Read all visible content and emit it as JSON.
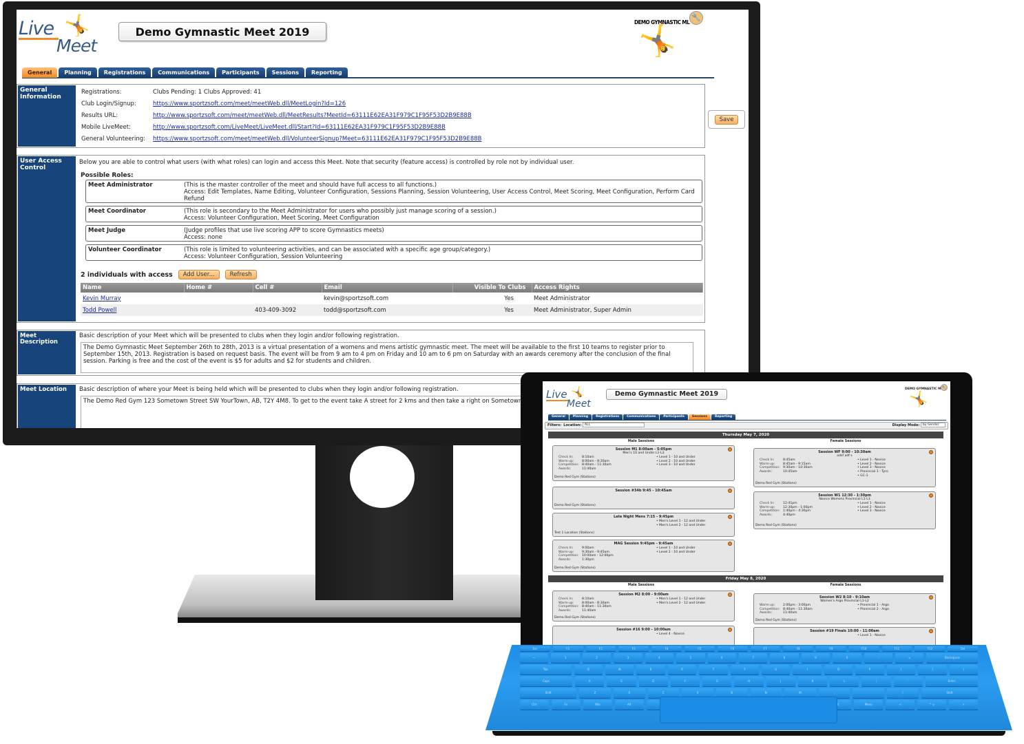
{
  "desktop": {
    "app_logo": {
      "line1": "Live",
      "line2": "Meet"
    },
    "meet_title": "Demo Gymnastic Meet 2019",
    "club_logo_text": "DEMO GYMNASTIC ML",
    "tabs": [
      {
        "label": "General",
        "active": true
      },
      {
        "label": "Planning",
        "active": false
      },
      {
        "label": "Registrations",
        "active": false
      },
      {
        "label": "Communications",
        "active": false
      },
      {
        "label": "Participants",
        "active": false
      },
      {
        "label": "Sessions",
        "active": false
      },
      {
        "label": "Reporting",
        "active": false
      }
    ],
    "save_label": "Save",
    "general_info": {
      "heading": "General Information",
      "rows": [
        {
          "label": "Registrations:",
          "value": "Clubs Pending: 1  Clubs Approved: 41",
          "link": false
        },
        {
          "label": "Club Login/Signup:",
          "value": "https://www.sportzsoft.com/meet/meetWeb.dll/MeetLogin?Id=126",
          "link": true
        },
        {
          "label": "Results URL:",
          "value": "http://www.sportzsoft.com/meet/meetWeb.dll/MeetResults?MeetId=63111E62EA31F979C1F95F53D2B9E88B",
          "link": true
        },
        {
          "label": "Mobile LiveMeet:",
          "value": "http://www.sportzsoft.com/LiveMeet/LiveMeet.dll/Start?Id=63111E62EA31F979C1F95F53D2B9E88B",
          "link": true
        },
        {
          "label": "General Volunteering:",
          "value": "https://www.sportzsoft.com/meet/meetWeb.dll/VolunteerSignup?Meet=63111E62EA31F979C1F95F53D2B9E88B",
          "link": true
        }
      ]
    },
    "user_access": {
      "heading": "User Access Control",
      "intro": "Below you are able to control what users (with what roles) can login and access this Meet. Note that security (feature access) is controlled by role not by individual user.",
      "roles_heading": "Possible Roles:",
      "roles": [
        {
          "name": "Meet Administrator",
          "desc": "(This is the master controller of the meet and should have full access to all functions.)",
          "access": "Access: Edit Templates, Name Editing, Volunteer Configuration, Sessions Planning, Session Volunteering, User Access Control, Meet Scoring, Meet Configuration, Perform Card Refund"
        },
        {
          "name": "Meet Coordinator",
          "desc": "(This role is secondary to the Meet Administrator for users who possibly just manage scoring of a session.)",
          "access": "Access: Volunteer Configuration, Meet Scoring, Meet Configuration"
        },
        {
          "name": "Meet Judge",
          "desc": "(Judge profiles that use live scoring APP to score Gymnastics meets)",
          "access": "Access: none"
        },
        {
          "name": "Volunteer Coordinator",
          "desc": "(This role is limited to volunteering activities, and can be associated with a specific age group/category.)",
          "access": "Access: Volunteer Configuration, Session Volunteering"
        }
      ],
      "count_label": "2 individuals with access",
      "add_user_label": "Add User...",
      "refresh_label": "Refresh",
      "columns": [
        "Name",
        "Home #",
        "Cell #",
        "Email",
        "Visible To Clubs",
        "Access Rights"
      ],
      "users": [
        {
          "name": "Kevin Murray",
          "home": "",
          "cell": "",
          "email": "kevin@sportzsoft.com",
          "visible": "Yes",
          "rights": "Meet Administrator"
        },
        {
          "name": "Todd Powell",
          "home": "",
          "cell": "403-409-3092",
          "email": "todd@sportzsoft.com",
          "visible": "Yes",
          "rights": "Meet Administrator, Super Admin"
        }
      ]
    },
    "meet_description": {
      "heading": "Meet Description",
      "hint": "Basic description of your Meet which will be presented to clubs when they login and/or following registration.",
      "value": "The Demo Gymnastic Meet September 26th to 28th,  2013 is a virtual presentation of a womens and mens artistic gymnastic meet. The meet will be available to the first 10 teams to register prior to September  15th, 2013. Registration is based on request basis. The event will be from 9 am to 4 pm on Friday and 10 am to 6 pm on Saturday with an awards ceremony after the conclusion of the final session. Parking is free and the cost of the event is $5 for adults and $2 for students and children."
    },
    "meet_location": {
      "heading": "Meet Location",
      "hint": "Basic description of where your Meet is being held which will be presented to clubs when they login and/or following registration.",
      "value": "The Demo Red Gym 123 Sometown Street SW YourTown, AB, T2Y 4M8. To get to the event take A street for 2 kms and then take a right on Sometown Parking is free for the weekend."
    }
  },
  "tablet": {
    "meet_title": "Demo Gymnastic Meet 2019",
    "club_logo_text": "DEMO GYMNASTIC ML",
    "tabs": [
      {
        "label": "General",
        "active": false
      },
      {
        "label": "Planning",
        "active": false
      },
      {
        "label": "Registrations",
        "active": false
      },
      {
        "label": "Communications",
        "active": false
      },
      {
        "label": "Participants",
        "active": false
      },
      {
        "label": "Sessions",
        "active": true
      },
      {
        "label": "Reporting",
        "active": false
      }
    ],
    "filters_label": "Filters:",
    "location_label": "Location:",
    "location_value": "ALL",
    "display_mode_label": "Display Mode:",
    "display_mode_value": "by Gender",
    "days": [
      {
        "date": "Thursday May 7, 2020",
        "male_heading": "Male Sessions",
        "female_heading": "Female Sessions",
        "male": [
          {
            "title": "Session M1 8:00am - 5:05pm",
            "subtitle": "Men's 10 and Under L1-L3",
            "times": [
              [
                "Check In:",
                "8:10am"
              ],
              [
                "Warm-up:",
                "8:00am - 8:30am"
              ],
              [
                "Competition:",
                "8:40am - 11:30am"
              ],
              [
                "Awards:",
                "11:40am"
              ]
            ],
            "levels": [
              "Level 1 - 10 and Under",
              "Level 2 - 10 and Under",
              "Level 3 - 10 and Under"
            ],
            "location": "Demo Red Gym (Stations)"
          },
          {
            "title": "Session #34b 9:45 - 10:45am",
            "subtitle": "",
            "times": [],
            "levels": [],
            "location": "Demo Red Gym (Stations)"
          },
          {
            "title": "Late Night Mens 7:15 - 9:45pm",
            "subtitle": "",
            "times": [],
            "levels": [
              "Men's Level 1 - 12 and Under",
              "Men's Level 2 - 12 and Under"
            ],
            "location": "Test 1 Location (Stations)"
          },
          {
            "title": "MAG Session 9:45pm - 9:45am",
            "subtitle": "",
            "times": [
              [
                "Check In:",
                "9:00am"
              ],
              [
                "Warm-up:",
                "9:30am - 9:45am"
              ],
              [
                "Competition:",
                "10:00am - 12:00pm"
              ],
              [
                "Awards:",
                "1:30pm"
              ]
            ],
            "levels": [
              "Level 1 - 10 and Under",
              "Level 2 - 10 and Under"
            ],
            "location": "Demo Red Gym (Stations)"
          }
        ],
        "female": [
          {
            "title": "Session WF 9:00 - 10:30am",
            "subtitle": "adsf adf s",
            "times": [
              [
                "Check In:",
                "8:45am"
              ],
              [
                "Warm-up:",
                "8:45am - 9:15am"
              ],
              [
                "Competition:",
                "9:30am - 10:30am"
              ],
              [
                "Awards:",
                "10:45am"
              ]
            ],
            "levels": [
              "Level 1 - Novice",
              "Level 2 - Novice",
              "Level 3 - Novice",
              "Provincial 1 - Tyro",
              "GC-1"
            ],
            "location": "Demo Red Gym (Stations)"
          },
          {
            "title": "Session W1 12:30 - 1:30pm",
            "subtitle": "Novice Womens Provincial L1-L3",
            "times": [
              [
                "Check In:",
                "12:41pm"
              ],
              [
                "Warm-up:",
                "12:30pm - 1:00pm"
              ],
              [
                "Competition:",
                "1:40pm - 4:30pm"
              ],
              [
                "Awards:",
                "4:40pm"
              ]
            ],
            "levels": [
              "Level 1 - Novice",
              "Level 2 - Novice",
              "Level 3 - Novice"
            ],
            "location": "Demo Red Gym (Stations)"
          }
        ]
      },
      {
        "date": "Friday May 8, 2020",
        "male_heading": "Male Sessions",
        "female_heading": "Female Sessions",
        "male": [
          {
            "title": "Session M2 8:00 - 9:00am",
            "subtitle": "",
            "times": [
              [
                "Check In:",
                "8:10am"
              ],
              [
                "Warm-up:",
                "8:00am - 8:30am"
              ],
              [
                "Competition:",
                "8:40am - 11:30am"
              ],
              [
                "Awards:",
                "11:40am"
              ]
            ],
            "levels": [
              "Men's Level 1 - 12 and Under",
              "Men's Level 2 - 12 and Under"
            ],
            "location": "Demo Red Gym (Stations)"
          },
          {
            "title": "Session #16 9:00 - 10:00am",
            "subtitle": "",
            "times": [],
            "levels": [
              "Level 4 - Novice"
            ],
            "location": ""
          }
        ],
        "female": [
          {
            "title": "Session W2 8:10 - 9:10am",
            "subtitle": "Women's Argo Provincial L1-L2",
            "times": [
              [
                "Warm-up:",
                "2:00pm - 3:00pm"
              ],
              [
                "Competition:",
                "8:40am - 11:30am"
              ],
              [
                "Awards:",
                "11:40am"
              ]
            ],
            "levels": [
              "Provincial 1 - Argo",
              "Provincial 2 - Argo"
            ],
            "location": "Demo Red Gym (Stations)"
          },
          {
            "title": "Session #19 Finals 10:00 - 11:00am",
            "subtitle": "",
            "times": [],
            "levels": [
              "Level 1 - Novice"
            ],
            "location": ""
          }
        ]
      }
    ]
  },
  "keyboard": {
    "rows": [
      [
        "Esc",
        "F1",
        "F2",
        "F3",
        "F4",
        "F5",
        "F6",
        "F7",
        "F8",
        "F9",
        "F10",
        "F11",
        "F12",
        "Del"
      ],
      [
        "~",
        "1",
        "2",
        "3",
        "4",
        "5",
        "6",
        "7",
        "8",
        "9",
        "0",
        "-",
        "=",
        "Backspace"
      ],
      [
        "Tab",
        "Q",
        "W",
        "E",
        "R",
        "T",
        "Y",
        "U",
        "I",
        "O",
        "P",
        "[",
        "]",
        "\\"
      ],
      [
        "Caps",
        "A",
        "S",
        "D",
        "F",
        "G",
        "H",
        "J",
        "K",
        "L",
        ";",
        "'",
        "Enter"
      ],
      [
        "Shift",
        "Z",
        "X",
        "C",
        "V",
        "B",
        "N",
        "M",
        ",",
        ".",
        "/",
        "Shift"
      ],
      [
        "Ctrl",
        "Fn",
        "Win",
        "Alt",
        "",
        "Alt",
        "Menu",
        "<",
        "^ v",
        ">"
      ]
    ]
  }
}
